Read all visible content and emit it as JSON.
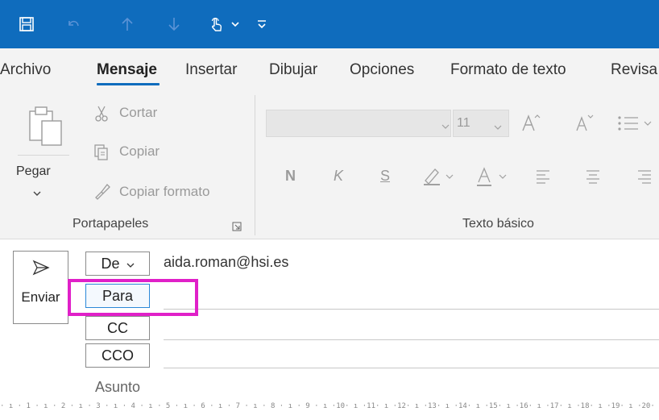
{
  "colors": {
    "titlebar": "#0f6cbd",
    "highlight": "#e020c8",
    "ribbon": "#f3f3f3"
  },
  "titlebar": {
    "icons": [
      "save-icon",
      "undo-icon",
      "up-arrow-icon",
      "down-arrow-icon",
      "touch-mode-icon",
      "chevron-down-icon",
      "customize-toolbar-icon"
    ]
  },
  "tabs": [
    {
      "label": "Archivo"
    },
    {
      "label": "Mensaje",
      "active": true
    },
    {
      "label": "Insertar"
    },
    {
      "label": "Dibujar"
    },
    {
      "label": "Opciones"
    },
    {
      "label": "Formato de texto"
    },
    {
      "label": "Revisa"
    }
  ],
  "clipboard": {
    "paste_label": "Pegar",
    "cut_label": "Cortar",
    "copy_label": "Copiar",
    "format_painter_label": "Copiar formato",
    "group_label": "Portapapeles"
  },
  "basic_text": {
    "font_size": "11",
    "bold_label": "N",
    "italic_label": "K",
    "underline_label": "S",
    "group_label": "Texto básico"
  },
  "compose": {
    "send_label": "Enviar",
    "from_label": "De",
    "from_value": "aida.roman@hsi.es",
    "to_label": "Para",
    "cc_label": "CC",
    "bcc_label": "CCO",
    "subject_label": "Asunto"
  },
  "ruler": {
    "text": "· ı · 1 · ı · 2 · ı · 3 · ı · 4 · ı · 5 · ı · 6 · ı · 7 · ı · 8 · ı · 9 · ı ·10· ı ·11· ı ·12· ı ·13· ı ·14· ı ·15· ı ·16· ı ·17· ı ·18· ı ·19· ı ·20·"
  }
}
